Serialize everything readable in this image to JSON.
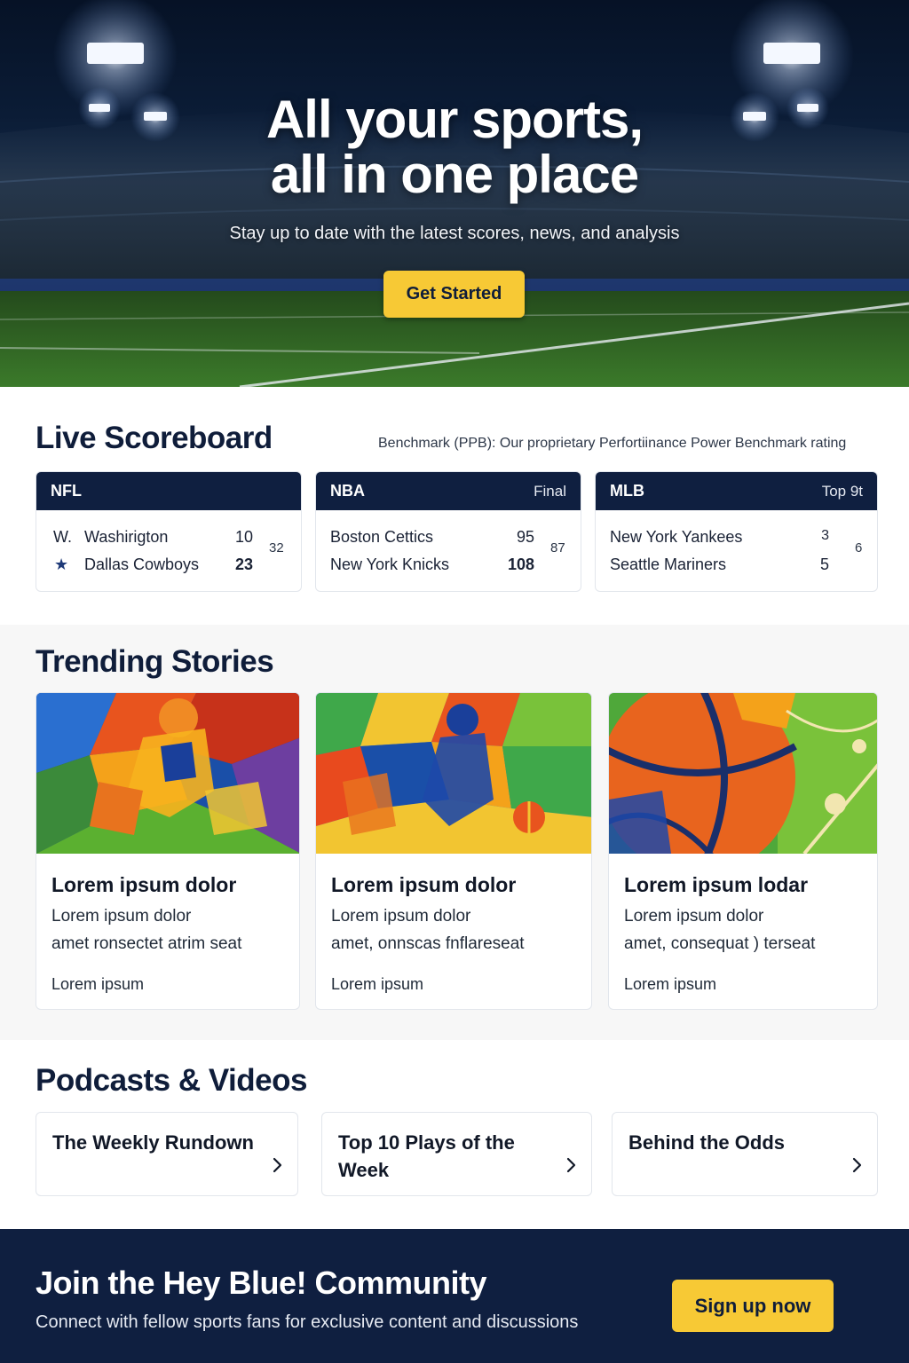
{
  "hero": {
    "title_line1": "All your sports,",
    "title_line2": "all in one place",
    "subtitle": "Stay up to date with the latest scores, news, and analysis",
    "cta_label": "Get Started"
  },
  "scoreboard": {
    "title": "Live Scoreboard",
    "benchmark_note": "Benchmark (PPB): Our proprietary Perfortiinance Power Benchmark rating",
    "games": [
      {
        "league": "NFL",
        "status": "",
        "teams": [
          {
            "prefix": "W.",
            "name": "Washirigton",
            "score": "10"
          },
          {
            "prefix": "★",
            "name": "Dallas Cowboys",
            "score": "23"
          }
        ],
        "side_value": "32"
      },
      {
        "league": "NBA",
        "status": "Final",
        "teams": [
          {
            "prefix": "",
            "name": "Boston Cettics",
            "score": "95"
          },
          {
            "prefix": "",
            "name": "New York Knicks",
            "score": "108"
          }
        ],
        "side_value": "87"
      },
      {
        "league": "MLB",
        "status": "Top 9t",
        "teams": [
          {
            "prefix": "",
            "name": "New York Yankees",
            "score": "3"
          },
          {
            "prefix": "",
            "name": "Seattle Mariners",
            "score": "5"
          }
        ],
        "side_value": "6"
      }
    ]
  },
  "trending": {
    "title": "Trending Stories",
    "stories": [
      {
        "title": "Lorem ipsum dolor",
        "line1": "Lorem ipsum dolor",
        "line2": "amet ronsectet atrim seat",
        "meta": "Lorem ipsum",
        "image": "abstract-football-player"
      },
      {
        "title": "Lorem ipsum dolor",
        "line1": "Lorem ipsum dolor",
        "line2": "amet, onnscas fnflareseat",
        "meta": "Lorem ipsum",
        "image": "abstract-soccer-player"
      },
      {
        "title": "Lorem ipsum lodar",
        "line1": "Lorem ipsum dolor",
        "line2": "amet, consequat ) terseat",
        "meta": "Lorem ipsum",
        "image": "abstract-basketball"
      }
    ]
  },
  "podcasts": {
    "title": "Podcasts & Videos",
    "items": [
      {
        "title": "The Weekly Rundown",
        "icon": "chevron-right-icon"
      },
      {
        "title": "Top 10 Plays of the Week",
        "icon": "chevron-right-icon"
      },
      {
        "title": "Behind the Odds",
        "icon": "chevron-right-icon"
      }
    ]
  },
  "footer": {
    "title": "Join the Hey Blue! Community",
    "subtitle": "Connect with fellow sports fans for exclusive content and discussions",
    "cta_label": "Sign up now"
  },
  "colors": {
    "navy": "#0f1f40",
    "accent_yellow": "#f7c935",
    "text_dark": "#0f1d3a"
  }
}
